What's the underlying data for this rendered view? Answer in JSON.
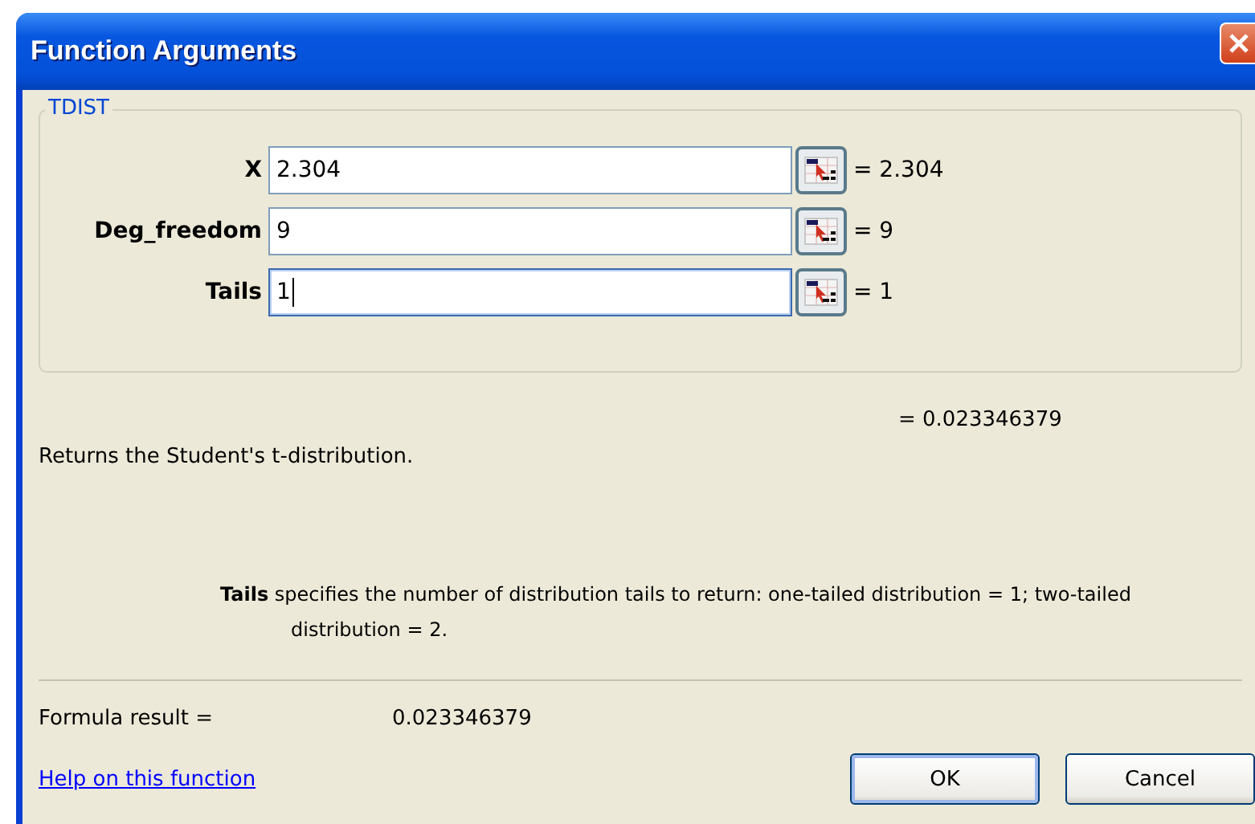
{
  "window": {
    "title": "Function Arguments"
  },
  "function_group": {
    "name": "TDIST",
    "arguments": [
      {
        "label": "X",
        "value": "2.304",
        "result": "= 2.304",
        "focused": false
      },
      {
        "label": "Deg_freedom",
        "value": "9",
        "result": "= 9",
        "focused": false
      },
      {
        "label": "Tails",
        "value": "1",
        "result": "= 1",
        "focused": true
      }
    ]
  },
  "overall_result": "= 0.023346379",
  "description": "Returns the Student's t-distribution.",
  "argument_help": "**Tails** specifies the number of distribution tails to return: one-tailed distribution = 1; two-tailed distribution = 2.",
  "formula_result": {
    "label": "Formula result =",
    "value": "0.023346379"
  },
  "help_link": "Help on this function",
  "buttons": [
    {
      "label": "OK",
      "kind": "default"
    },
    {
      "label": "Cancel",
      "kind": "normal"
    }
  ]
}
